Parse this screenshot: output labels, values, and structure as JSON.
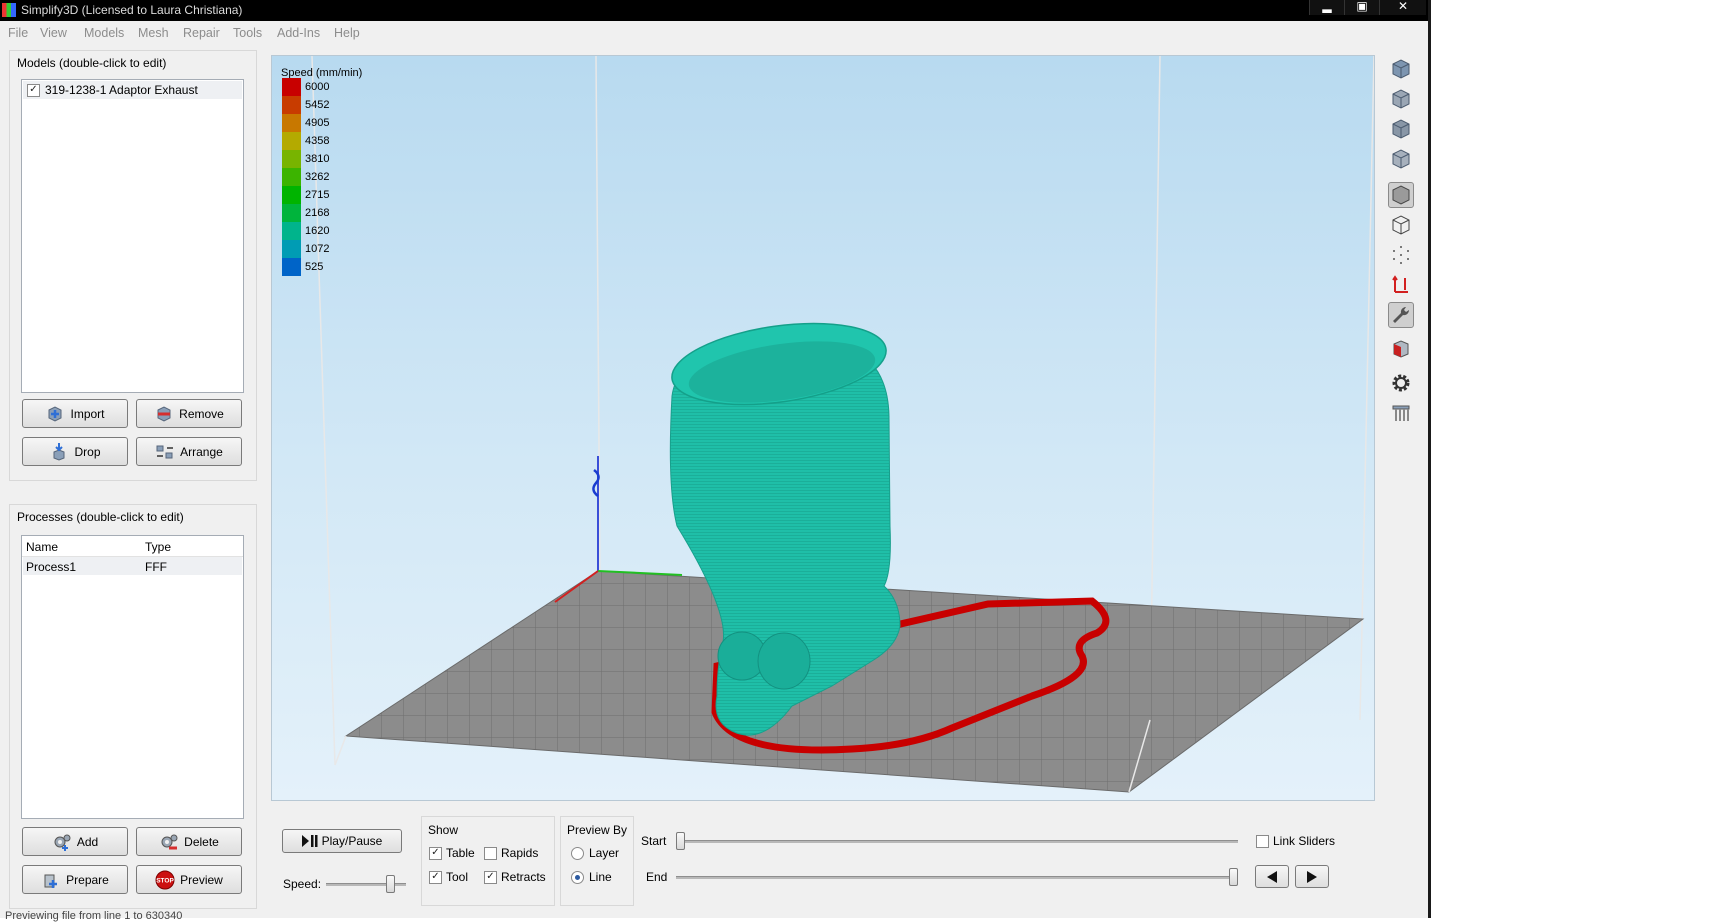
{
  "window": {
    "title": "Simplify3D (Licensed to Laura Christiana)",
    "controls": [
      "minimize",
      "maximize",
      "close"
    ]
  },
  "menu": [
    "File",
    "View",
    "Models",
    "Mesh",
    "Repair",
    "Tools",
    "Add-Ins",
    "Help"
  ],
  "models_panel": {
    "label": "Models (double-click to edit)",
    "items": [
      {
        "name": "319-1238-1 Adaptor Exhaust",
        "checked": true
      }
    ],
    "buttons": {
      "import": "Import",
      "remove": "Remove",
      "drop": "Drop",
      "arrange": "Arrange"
    }
  },
  "processes_panel": {
    "label": "Processes (double-click to edit)",
    "columns": [
      "Name",
      "Type"
    ],
    "rows": [
      {
        "name": "Process1",
        "type": "FFF"
      }
    ],
    "buttons": {
      "add": "Add",
      "delete": "Delete",
      "prepare": "Prepare",
      "preview": "Preview",
      "stop_badge": "STOP"
    }
  },
  "legend": {
    "title": "Speed (mm/min)",
    "items": [
      {
        "value": "6000",
        "color": "#c80000"
      },
      {
        "value": "5452",
        "color": "#c83c00"
      },
      {
        "value": "4905",
        "color": "#c87800"
      },
      {
        "value": "4358",
        "color": "#b4aa00"
      },
      {
        "value": "3810",
        "color": "#78b400"
      },
      {
        "value": "3262",
        "color": "#3cb400"
      },
      {
        "value": "2715",
        "color": "#00b400"
      },
      {
        "value": "2168",
        "color": "#00b43c"
      },
      {
        "value": "1620",
        "color": "#00b48c"
      },
      {
        "value": "1072",
        "color": "#009cb4"
      },
      {
        "value": "525",
        "color": "#0064c8"
      }
    ]
  },
  "colors": {
    "model": "#1fbfa8",
    "skirt": "#c80000",
    "bed": "#8c8c8c"
  },
  "toolbar_icons": [
    "view-iso-icon",
    "view-front-icon",
    "view-side-icon",
    "view-top-icon",
    "solid-view-icon",
    "wireframe-view-icon",
    "point-cloud-icon",
    "axis-arrows-icon",
    "wrench-icon",
    "cross-section-icon",
    "settings-gear-icon",
    "support-icon"
  ],
  "playback": {
    "play_pause": "Play/Pause",
    "speed_label": "Speed:",
    "speed_level": 0.85,
    "show_label": "Show",
    "show": [
      {
        "label": "Table",
        "checked": true
      },
      {
        "label": "Rapids",
        "checked": false
      },
      {
        "label": "Tool",
        "checked": true
      },
      {
        "label": "Retracts",
        "checked": true
      }
    ],
    "preview_by_label": "Preview By",
    "preview_by": [
      {
        "label": "Layer",
        "selected": false
      },
      {
        "label": "Line",
        "selected": true
      }
    ],
    "start_label": "Start",
    "end_label": "End",
    "start_position": 0.0,
    "end_position": 1.0,
    "link_sliders": "Link Sliders",
    "link_checked": false
  },
  "status": "Previewing file from line 1 to 630340"
}
